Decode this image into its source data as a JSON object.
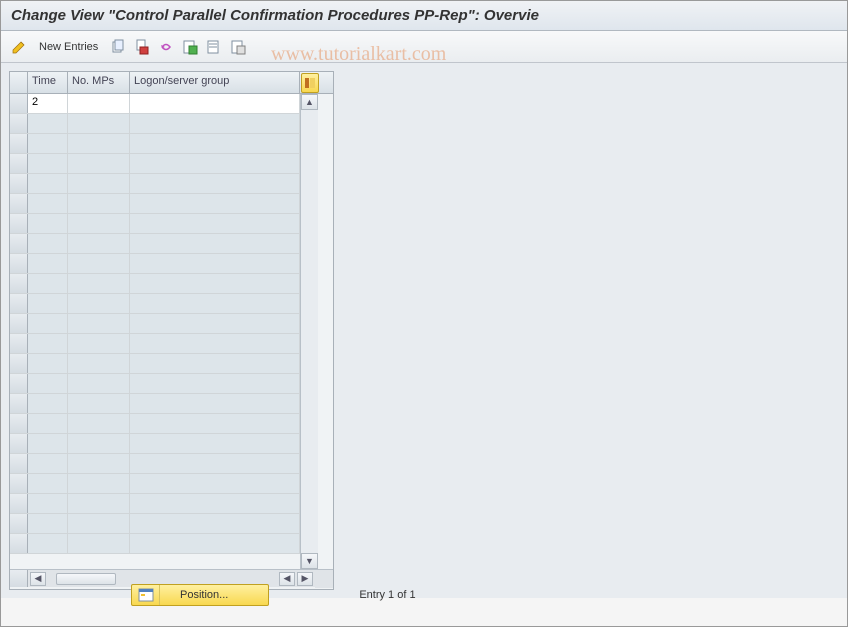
{
  "title": "Change View \"Control Parallel Confirmation Procedures PP-Rep\": Overvie",
  "watermark": "www.tutorialkart.com",
  "toolbar": {
    "new_entries_label": "New Entries"
  },
  "table": {
    "columns": {
      "time": "Time",
      "no_mps": "No. MPs",
      "logon_group": "Logon/server group"
    },
    "rows": [
      {
        "time": "2",
        "no_mps": "",
        "logon_group": ""
      }
    ]
  },
  "footer": {
    "position_label": "Position...",
    "entry_text": "Entry 1 of 1"
  }
}
